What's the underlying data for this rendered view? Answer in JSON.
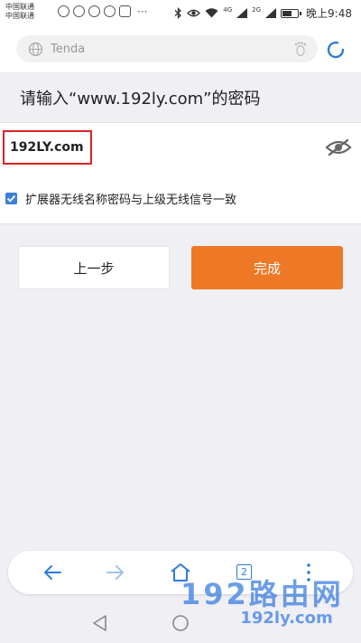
{
  "status_bar": {
    "carrier_1": "中国联通",
    "carrier_2": "中国联通",
    "more": "···",
    "clock": "晚上9:48",
    "net_1": "4G",
    "net_2": "2G",
    "app_icons": [
      "weibo-icon",
      "wechat-icon",
      "qq-icon",
      "qq-icon",
      "calendar-icon"
    ]
  },
  "browser": {
    "address_placeholder": "Tenda",
    "open_tabs": "2"
  },
  "page": {
    "heading": "请输入“www.192ly.com”的密码",
    "password_value": "192LY.com",
    "sync_checkbox_label": "扩展器无线名称密码与上级无线信号一致",
    "sync_checked": true,
    "prev_button": "上一步",
    "done_button": "完成"
  },
  "watermark": {
    "big": "192路由网",
    "small": "192ly.com"
  },
  "colors": {
    "accent_orange": "#ef7826",
    "browser_blue": "#2f7cd8",
    "highlight_red": "#dd2222",
    "checkbox_blue": "#3b7fd6"
  }
}
